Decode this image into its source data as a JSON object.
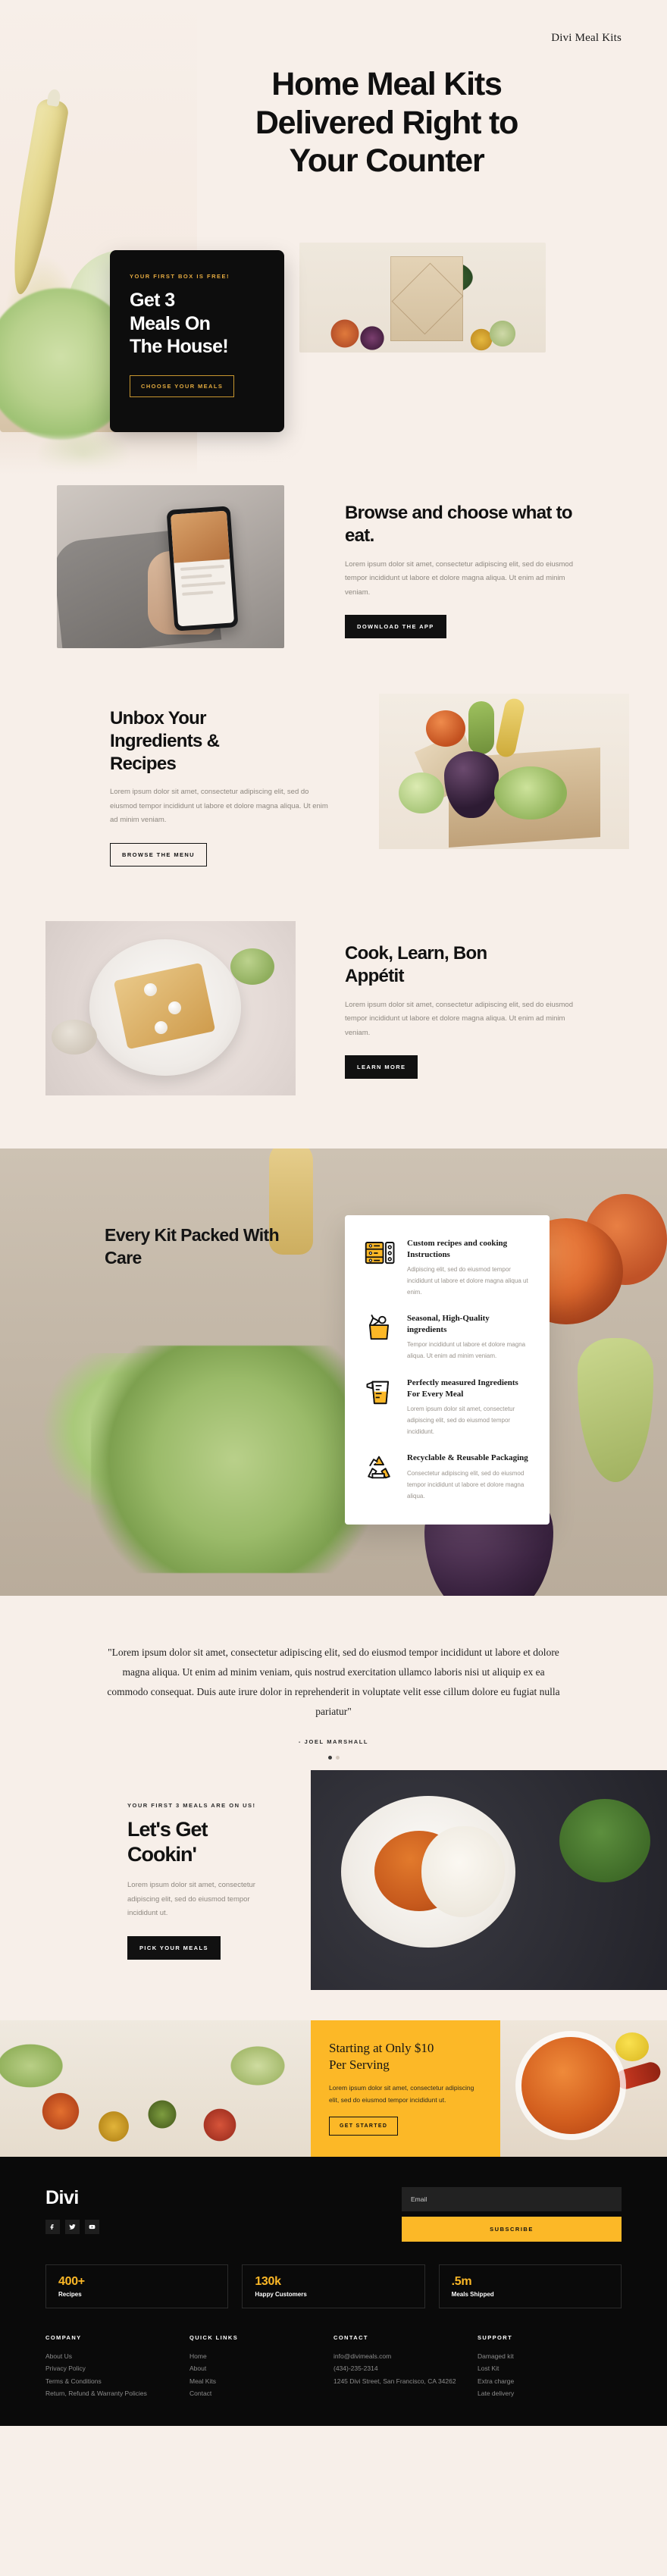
{
  "brand": {
    "top_label": "Divi Meal Kits",
    "footer_logo": "Divi"
  },
  "hero": {
    "title_line1": "Home Meal Kits",
    "title_line2": "Delivered Right to",
    "title_line3": "Your Counter",
    "offer": {
      "eyebrow": "YOUR FIRST BOX IS FREE!",
      "title_line1": "Get 3",
      "title_line2": "Meals On",
      "title_line3": "The House!",
      "button": "CHOOSE YOUR MEALS"
    }
  },
  "sections": [
    {
      "heading": "Browse and choose what to eat.",
      "body": "Lorem ipsum dolor  sit amet, consectetur adipiscing elit, sed do eiusmod tempor incididunt ut labore et dolore magna aliqua. Ut enim ad minim veniam.",
      "button": "DOWNLOAD THE APP"
    },
    {
      "heading": "Unbox Your Ingredients & Recipes",
      "body": "Lorem ipsum dolor sit amet, consectetur adipiscing elit, sed do eiusmod tempor incididunt ut labore et dolore magna aliqua. Ut enim ad minim veniam.",
      "button": "BROWSE THE MENU"
    },
    {
      "heading": "Cook, Learn, Bon Appétit",
      "body": "Lorem ipsum dolor sit amet, consectetur adipiscing elit, sed do eiusmod tempor incididunt ut labore et dolore magna aliqua. Ut enim ad minim veniam.",
      "button": "LEARN MORE"
    }
  ],
  "care": {
    "title": "Every Kit Packed With Care",
    "features": [
      {
        "icon": "recipe-card-icon",
        "title": "Custom recipes and cooking Instructions",
        "body": "Adipiscing elit, sed do eiusmod tempor incididunt ut labore et dolore magna aliqua ut enim."
      },
      {
        "icon": "grocery-bag-icon",
        "title": "Seasonal, High-Quality ingredients",
        "body": "Tempor incididunt ut labore et dolore magna aliqua. Ut enim ad minim veniam."
      },
      {
        "icon": "measuring-cup-icon",
        "title": "Perfectly measured Ingredients For Every Meal",
        "body": "Lorem ipsum dolor sit amet, consectetur adipiscing elit, sed do eiusmod tempor incididunt."
      },
      {
        "icon": "recycle-icon",
        "title": "Recyclable & Reusable Packaging",
        "body": "Consectetur adipiscing elit, sed do eiusmod tempor incididunt ut labore et dolore magna aliqua."
      }
    ]
  },
  "testimonial": {
    "quote": "\"Lorem ipsum dolor sit amet, consectetur adipiscing elit, sed do eiusmod tempor incididunt ut labore et dolore magna aliqua. Ut enim ad minim veniam, quis nostrud exercitation ullamco laboris nisi ut aliquip ex ea commodo consequat. Duis aute irure dolor in reprehenderit in voluptate velit esse cillum dolore eu fugiat nulla pariatur\"",
    "author": "- JOEL MARSHALL"
  },
  "cookin": {
    "eyebrow": "YOUR FIRST 3 MEALS ARE ON US!",
    "title_line1": "Let's Get",
    "title_line2": "Cookin'",
    "body": "Lorem ipsum dolor sit amet, consectetur adipiscing elit, sed do eiusmod tempor incididunt ut.",
    "button": "PICK YOUR MEALS"
  },
  "pricing": {
    "title_line1": "Starting at Only $10",
    "title_line2": "Per Serving",
    "body": "Lorem ipsum dolor sit amet, consectetur adipiscing elit, sed do eiusmod tempor incididunt ut.",
    "button": "GET STARTED"
  },
  "footer": {
    "newsletter": {
      "placeholder": "Email",
      "value": "",
      "button": "SUBSCRIBE"
    },
    "socials": [
      "facebook-icon",
      "twitter-icon",
      "youtube-icon"
    ],
    "stats": [
      {
        "number": "400+",
        "label": "Recipes"
      },
      {
        "number": "130k",
        "label": "Happy Customers"
      },
      {
        "number": ".5m",
        "label": "Meals Shipped"
      }
    ],
    "columns": [
      {
        "title": "COMPANY",
        "items": [
          "About Us",
          "Privacy Policy",
          "Terms & Conditions",
          "Return, Refund & Warranty Policies"
        ]
      },
      {
        "title": "QUICK LINKS",
        "items": [
          "Home",
          "About",
          "Meal Kits",
          "Contact"
        ]
      },
      {
        "title": "CONTACT",
        "items": [
          "info@divimeals.com",
          "(434)-235-2314",
          "1245 Divi Street, San Francisco, CA 34262"
        ]
      },
      {
        "title": "SUPPORT",
        "items": [
          "Damaged kit",
          "Lost Kit",
          "Extra charge",
          "Late delivery"
        ]
      }
    ]
  },
  "colors": {
    "bg": "#f7efe9",
    "accent": "#fcb827",
    "dark": "#0a0a0a",
    "gold": "#e0a93f"
  }
}
